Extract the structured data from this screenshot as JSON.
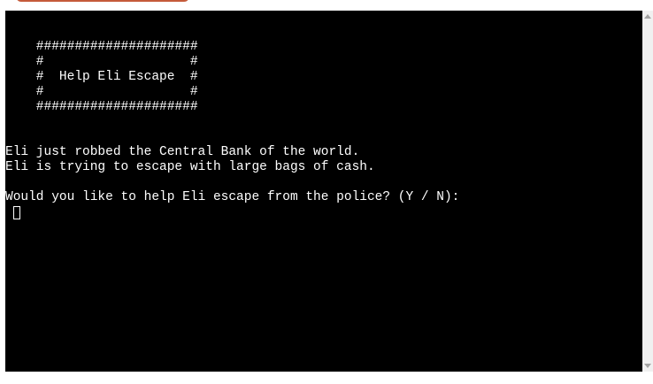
{
  "terminal": {
    "lines": [
      "    #####################",
      "    #                   #",
      "    #  Help Eli Escape  #",
      "    #                   #",
      "    #####################",
      "",
      "",
      "Eli just robbed the Central Bank of the world.",
      "Eli is trying to escape with large bags of cash.",
      "",
      "Would you like to help Eli escape from the police? (Y / N):"
    ]
  },
  "colors": {
    "terminal_bg": "#000000",
    "terminal_fg": "#ffffff",
    "run_button": "#c55a3a",
    "scrollbar_track": "#f0f0f0"
  },
  "icons": {
    "scroll_up": "scroll-up-arrow-icon",
    "scroll_down": "scroll-down-arrow-icon"
  }
}
